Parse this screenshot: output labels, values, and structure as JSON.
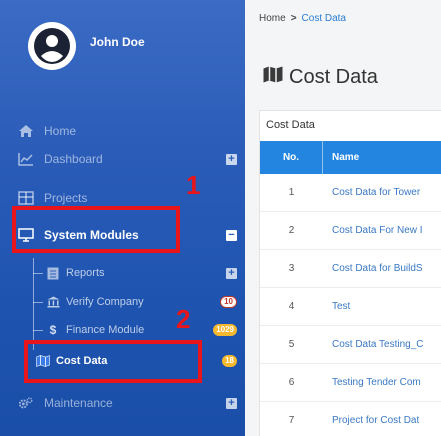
{
  "user": {
    "name": "John Doe"
  },
  "sidebar": {
    "items": [
      {
        "label": "Home",
        "icon": "home-icon"
      },
      {
        "label": "Dashboard",
        "icon": "chart-icon",
        "toggle": "+"
      },
      {
        "label": "Projects",
        "icon": "table-icon"
      },
      {
        "label": "System Modules",
        "icon": "monitor-icon",
        "toggle": "−"
      },
      {
        "label": "Maintenance",
        "icon": "gears-icon",
        "toggle": "+"
      }
    ],
    "sub_items": [
      {
        "label": "Reports",
        "icon": "report-icon",
        "toggle": "+"
      },
      {
        "label": "Verify Company",
        "icon": "bank-icon",
        "badge": "10"
      },
      {
        "label": "Finance Module",
        "icon": "dollar-icon",
        "badge": "1029"
      },
      {
        "label": "Cost Data",
        "icon": "map-icon",
        "badge": "18"
      }
    ]
  },
  "annotations": {
    "one": "1",
    "two": "2"
  },
  "breadcrumb": {
    "home": "Home",
    "sep": ">",
    "current": "Cost Data"
  },
  "page": {
    "title": "Cost Data"
  },
  "card": {
    "title": "Cost Data"
  },
  "table": {
    "headers": {
      "no": "No.",
      "name": "Name"
    },
    "rows": [
      {
        "no": "1",
        "name": "Cost Data for Tower"
      },
      {
        "no": "2",
        "name": "Cost Data For New I"
      },
      {
        "no": "3",
        "name": "Cost Data for BuildS"
      },
      {
        "no": "4",
        "name": "Test"
      },
      {
        "no": "5",
        "name": "Cost Data Testing_C"
      },
      {
        "no": "6",
        "name": "Testing Tender Com"
      },
      {
        "no": "7",
        "name": "Project for Cost Dat"
      }
    ]
  },
  "colors": {
    "sidebar": "#2a5cb8",
    "accent": "#2385e0",
    "highlight": "#e8151b",
    "badge_yellow": "#f5b82e"
  }
}
